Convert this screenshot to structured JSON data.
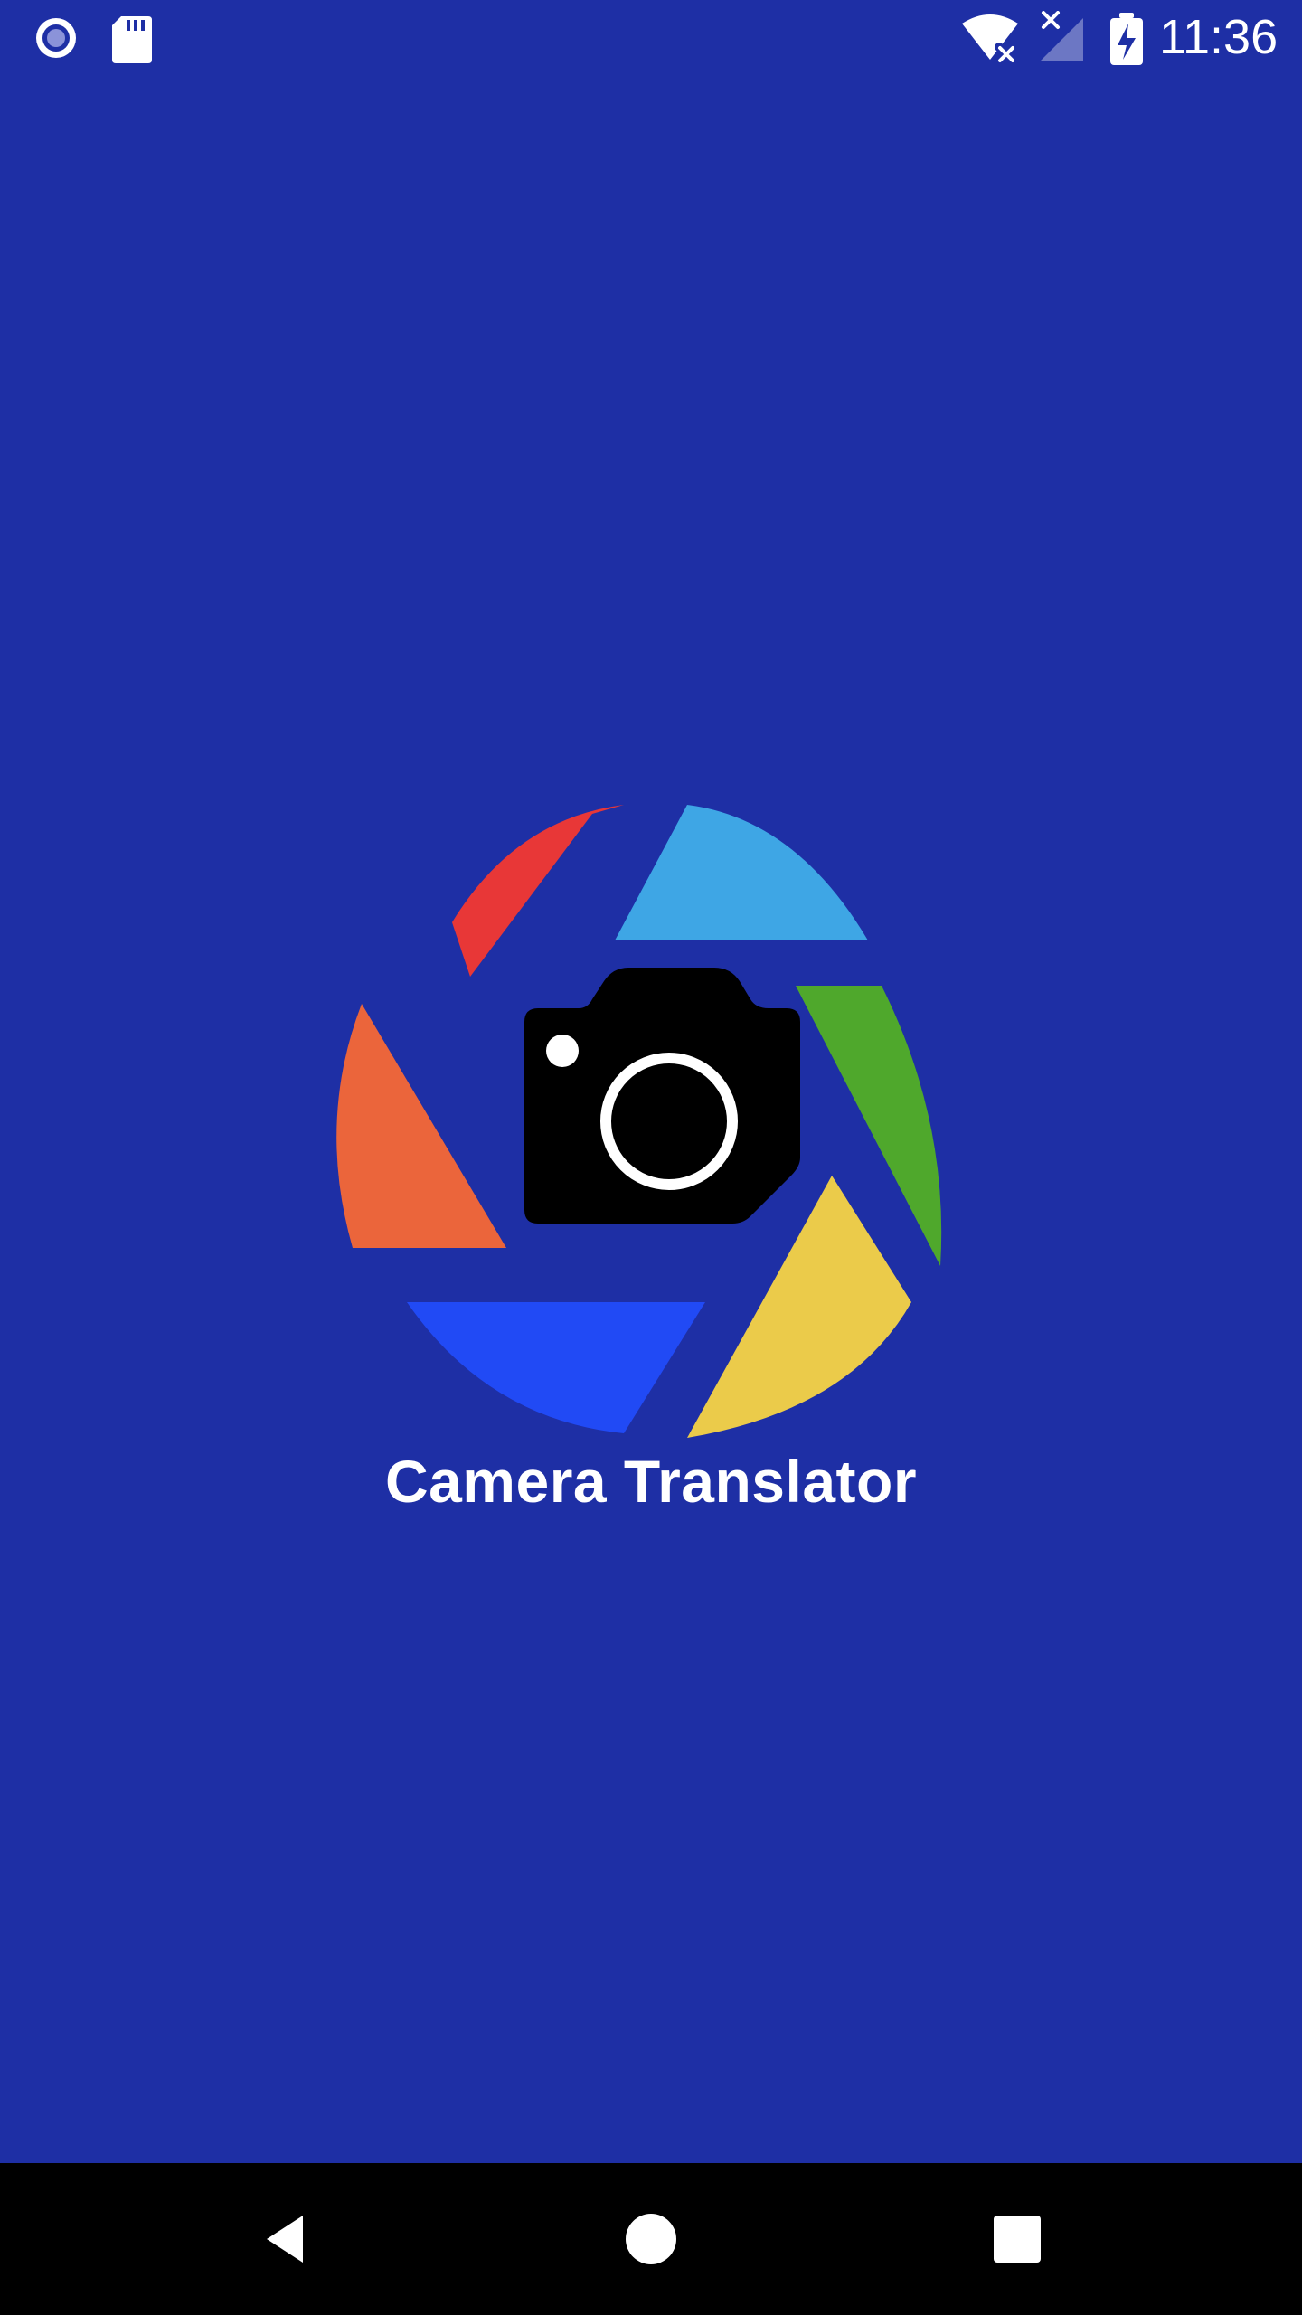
{
  "status_bar": {
    "time": "11:36",
    "icons": {
      "left": [
        "record-icon",
        "sd-card-icon"
      ],
      "right": [
        "wifi-icon",
        "no-signal-icon",
        "battery-charging-icon"
      ]
    }
  },
  "app": {
    "title": "Camera Translator",
    "logo": {
      "center_icon": "camera-icon",
      "aperture_colors": [
        "#E83737",
        "#3EA6E5",
        "#4FA82C",
        "#EBCB4A",
        "#214AF5",
        "#EB653B"
      ]
    },
    "background_color": "#1E2FA5"
  },
  "navigation_bar": {
    "buttons": [
      "back-button",
      "home-button",
      "recents-button"
    ]
  }
}
